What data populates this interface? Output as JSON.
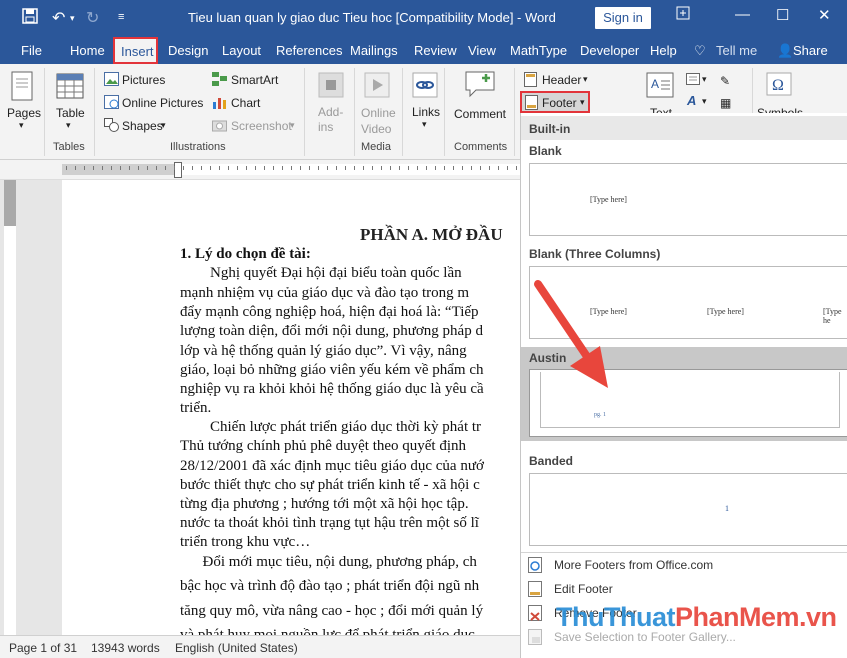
{
  "titlebar": {
    "doc_title": "Tieu luan quan ly giao duc Tieu hoc [Compatibility Mode]  -  Word",
    "sign_in": "Sign in"
  },
  "tabs": [
    "File",
    "Home",
    "Insert",
    "Design",
    "Layout",
    "References",
    "Mailings",
    "Review",
    "View",
    "MathType",
    "Developer",
    "Help"
  ],
  "tell_me": "Tell me",
  "share": "Share",
  "ribbon": {
    "pages": "Pages",
    "table": "Table",
    "tables_group": "Tables",
    "pictures": "Pictures",
    "online_pictures": "Online Pictures",
    "shapes": "Shapes",
    "smartart": "SmartArt",
    "chart": "Chart",
    "screenshot": "Screenshot",
    "illustrations_group": "Illustrations",
    "addins": "Add-ins",
    "online_video": "Online Video",
    "media_group": "Media",
    "links": "Links",
    "comment": "Comment",
    "comments_group": "Comments",
    "header": "Header",
    "footer": "Footer",
    "text": "Text",
    "symbols": "Symbols"
  },
  "document": {
    "heading": "PHẦN A.  MỞ ĐẦU",
    "lines": [
      "1. Lý do chọn đề tài:",
      "        Nghị quyết Đại hội đại biểu toàn quốc lần",
      "mạnh nhiệm vụ của giáo dục và đào tạo  trong m",
      "đẩy mạnh công nghiệp hoá, hiện đại hoá là: “Tiếp",
      "lượng toàn diện, đổi mới nội dung, phương pháp d",
      "lớp và hệ thống quản lý giáo dục”. Vì vậy, nâng",
      "giáo, loại bỏ những giáo viên yếu kém về phẩm ch",
      "nghiệp vụ ra khỏi khỏi hệ thống giáo dục là yêu cầ",
      "triển.",
      "        Chiến lược phát triển giáo dục thời kỳ phát tr",
      "Thủ tướng chính phủ phê duyệt theo quyết định",
      "28/12/2001 đã xác định mục tiêu giáo dục của nướ",
      "bước thiết thực cho sự phát triển kinh tế - xã hội c",
      "từng địa phương ; hướng tới một xã hội học tập.",
      "nước ta thoát khỏi tình trạng tụt hậu trên một số lĩ",
      "triển trong khu vực…",
      "      Đổi mới mục tiêu, nội dung, phương pháp, ch",
      "bậc học và trình độ đào tạo ; phát triển đội ngũ nh",
      "tăng quy mô, vừa nâng cao - học ; đổi mới quản lý",
      "và phát huy mọi nguồn lực để phát triển giáo dục."
    ]
  },
  "statusbar": {
    "page": "Page 1 of 31",
    "words": "13943 words",
    "language": "English (United States)"
  },
  "gallery": {
    "builtin": "Built-in",
    "items": [
      {
        "name": "Blank",
        "placeholders": [
          "[Type here]"
        ]
      },
      {
        "name": "Blank (Three Columns)",
        "placeholders": [
          "[Type here]",
          "[Type here]",
          "[Type he"
        ]
      },
      {
        "name": "Austin",
        "placeholders": [
          "pg. 1"
        ]
      },
      {
        "name": "Banded",
        "placeholders": [
          "1"
        ]
      }
    ],
    "menu": [
      "More Footers from Office.com",
      "Edit Footer",
      "Remove Footer",
      "Save Selection to Footer Gallery..."
    ]
  },
  "watermark": "ThuThuatPhanMem.vn",
  "colors": {
    "word_blue": "#2b579a",
    "highlight_red": "#e2343a",
    "arrow_red": "#e8463c"
  }
}
